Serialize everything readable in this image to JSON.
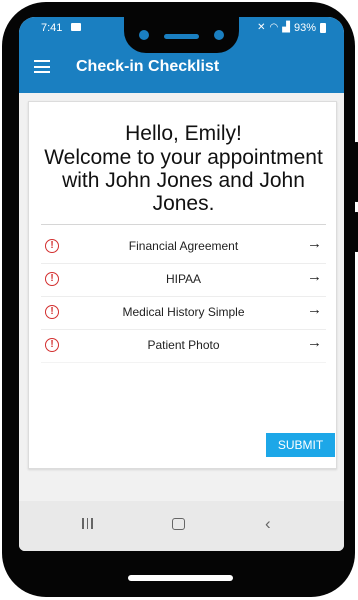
{
  "status_bar": {
    "time": "7:41",
    "battery": "93%",
    "icons": [
      "message-icon",
      "mute-icon",
      "wifi-icon",
      "signal-icon",
      "battery-icon"
    ]
  },
  "app_bar": {
    "title": "Check-in Checklist",
    "menu_icon": "hamburger-menu-icon",
    "color": "#1a7fc1"
  },
  "welcome": {
    "greeting": "Hello, Emily!",
    "message": "Welcome to your appointment with John Jones and John Jones."
  },
  "checklist": {
    "items": [
      {
        "label": "Financial Agreement",
        "status_icon": "alert-circle-icon",
        "action_icon": "arrow-right-icon"
      },
      {
        "label": "HIPAA",
        "status_icon": "alert-circle-icon",
        "action_icon": "arrow-right-icon"
      },
      {
        "label": "Medical History Simple",
        "status_icon": "alert-circle-icon",
        "action_icon": "arrow-right-icon"
      },
      {
        "label": "Patient Photo",
        "status_icon": "alert-circle-icon",
        "action_icon": "arrow-right-icon"
      }
    ],
    "status_color": "#d32f2f"
  },
  "actions": {
    "submit_label": "SUBMIT",
    "submit_color": "#1da7e8"
  },
  "nav_bar": {
    "icons": [
      "recents-icon",
      "home-icon",
      "back-icon"
    ]
  }
}
